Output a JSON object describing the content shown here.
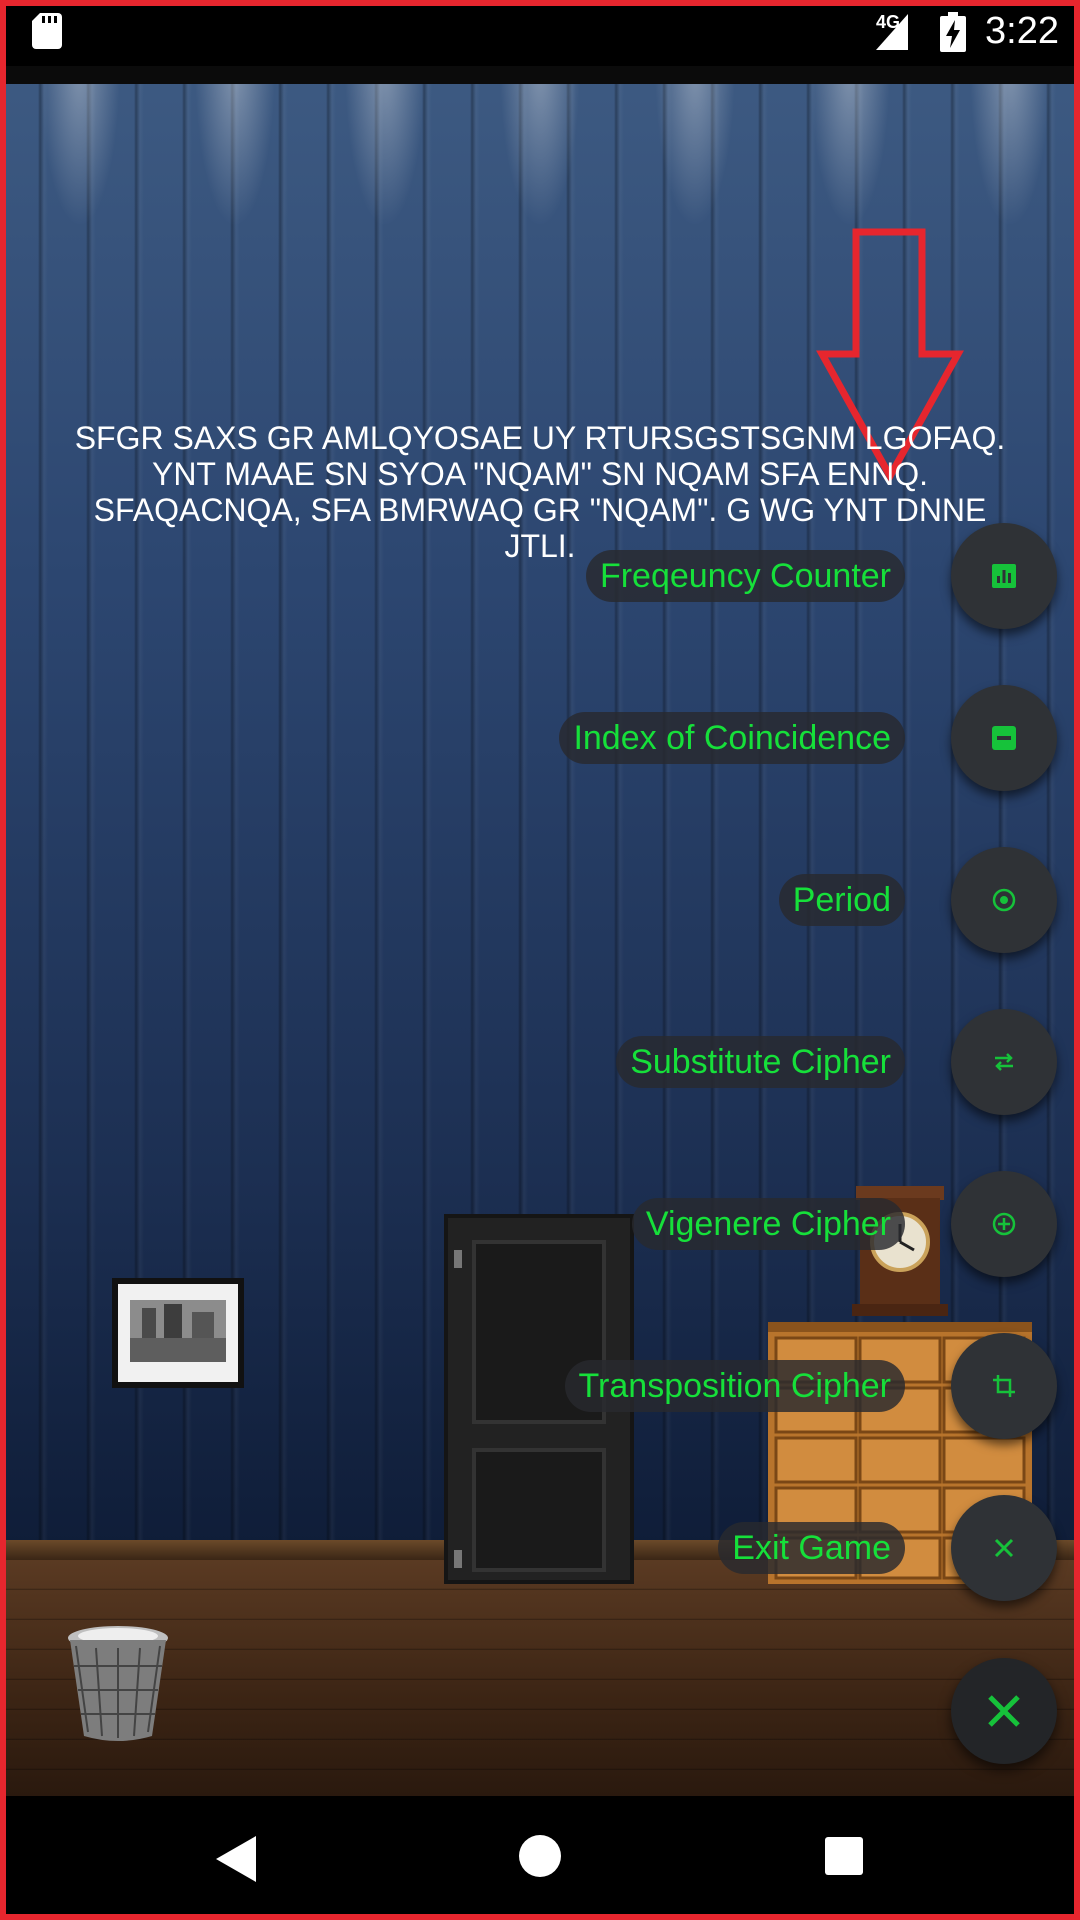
{
  "status_bar": {
    "network": "4G",
    "time": "3:22"
  },
  "cipher_text": "SFGR SAXS GR AMLQYOSAE UY RTURSGSTSGNM LGOFAQ. YNT MAAE SN SYOA \"NQAM\" SN NQAM SFA ENNQ. SFAQACNQA, SFA BMRWAQ GR \"NQAM\". G WG YNT DNNE JTLI.",
  "fab_menu": {
    "items": [
      {
        "label": "Freqeuncy Counter",
        "icon": "bar-chart-icon"
      },
      {
        "label": "Index of Coincidence",
        "icon": "minus-box-icon"
      },
      {
        "label": "Period",
        "icon": "target-icon"
      },
      {
        "label": "Substitute Cipher",
        "icon": "swap-arrows-icon"
      },
      {
        "label": "Vigenere Cipher",
        "icon": "plus-circle-icon"
      },
      {
        "label": "Transposition Cipher",
        "icon": "crop-rotate-icon"
      },
      {
        "label": "Exit Game",
        "icon": "close-icon"
      }
    ],
    "main_icon": "close-icon"
  },
  "colors": {
    "label_text": "#16e03a",
    "frame": "#e6262e",
    "fab_background": "#2f3236"
  },
  "nav_bar": {
    "icons": [
      "back-icon",
      "home-icon",
      "recents-icon"
    ]
  }
}
